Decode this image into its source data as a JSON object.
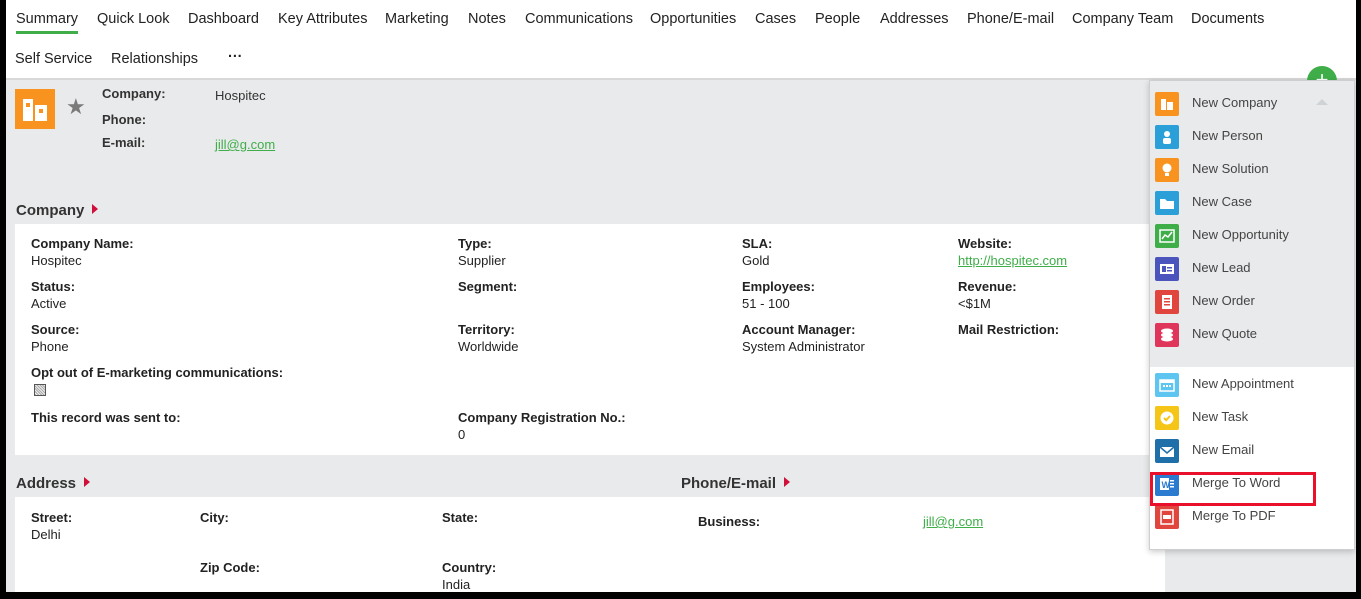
{
  "tabs": [
    "Summary",
    "Quick Look",
    "Dashboard",
    "Key Attributes",
    "Marketing",
    "Notes",
    "Communications",
    "Opportunities",
    "Cases",
    "People",
    "Addresses",
    "Phone/E-mail",
    "Company Team",
    "Documents",
    "Self Service",
    "Relationships",
    "···"
  ],
  "header": {
    "company_label": "Company:",
    "company_value": "Hospitec",
    "phone_label": "Phone:",
    "phone_value": "",
    "email_label": "E-mail:",
    "email_value": "jill@g.com"
  },
  "company_section": {
    "title": "Company",
    "fields": [
      {
        "label": "Company Name:",
        "value": "Hospitec"
      },
      {
        "label": "Type:",
        "value": "Supplier"
      },
      {
        "label": "SLA:",
        "value": "Gold"
      },
      {
        "label": "Website:",
        "value": "http://hospitec.com"
      },
      {
        "label": "Status:",
        "value": "Active"
      },
      {
        "label": "Segment:",
        "value": ""
      },
      {
        "label": "Employees:",
        "value": "51 - 100"
      },
      {
        "label": "Revenue:",
        "value": "<$1M"
      },
      {
        "label": "Source:",
        "value": "Phone"
      },
      {
        "label": "Territory:",
        "value": "Worldwide"
      },
      {
        "label": "Account Manager:",
        "value": "System Administrator"
      },
      {
        "label": "Mail Restriction:",
        "value": ""
      },
      {
        "label": "Opt out of E-marketing communications:",
        "value": ""
      },
      {
        "label": "This record was sent to:",
        "value": ""
      },
      {
        "label": "Company Registration No.:",
        "value": "0"
      }
    ]
  },
  "address_section": {
    "title": "Address",
    "street_label": "Street:",
    "street_value": "Delhi",
    "city_label": "City:",
    "city_value": "",
    "state_label": "State:",
    "state_value": "",
    "zip_label": "Zip Code:",
    "zip_value": "",
    "country_label": "Country:",
    "country_value": "India"
  },
  "phone_section": {
    "title": "Phone/E-mail",
    "business_label": "Business:",
    "business_value": "jill@g.com"
  },
  "new_menu": {
    "plus_label": "+",
    "items": [
      {
        "label": "New Company",
        "icon": "company-icon",
        "color": "#f7931e"
      },
      {
        "label": "New Person",
        "icon": "person-icon",
        "color": "#2a9fd8"
      },
      {
        "label": "New Solution",
        "icon": "lightbulb-icon",
        "color": "#f7931e"
      },
      {
        "label": "New Case",
        "icon": "folder-icon",
        "color": "#2a9fd8"
      },
      {
        "label": "New Opportunity",
        "icon": "trend-icon",
        "color": "#3fae49"
      },
      {
        "label": "New Lead",
        "icon": "lead-card-icon",
        "color": "#4b53bc"
      },
      {
        "label": "New Order",
        "icon": "order-icon",
        "color": "#e0463d"
      },
      {
        "label": "New Quote",
        "icon": "quote-icon",
        "color": "#e0355b"
      },
      {
        "label": "New Appointment",
        "icon": "calendar-icon",
        "color": "#5ec4f0"
      },
      {
        "label": "New Task",
        "icon": "task-check-icon",
        "color": "#f5c518"
      },
      {
        "label": "New Email",
        "icon": "envelope-icon",
        "color": "#1f6fa8"
      },
      {
        "label": "Merge To Word",
        "icon": "word-icon",
        "color": "#2a7ad0"
      },
      {
        "label": "Merge To PDF",
        "icon": "pdf-icon",
        "color": "#e0463d"
      }
    ]
  }
}
